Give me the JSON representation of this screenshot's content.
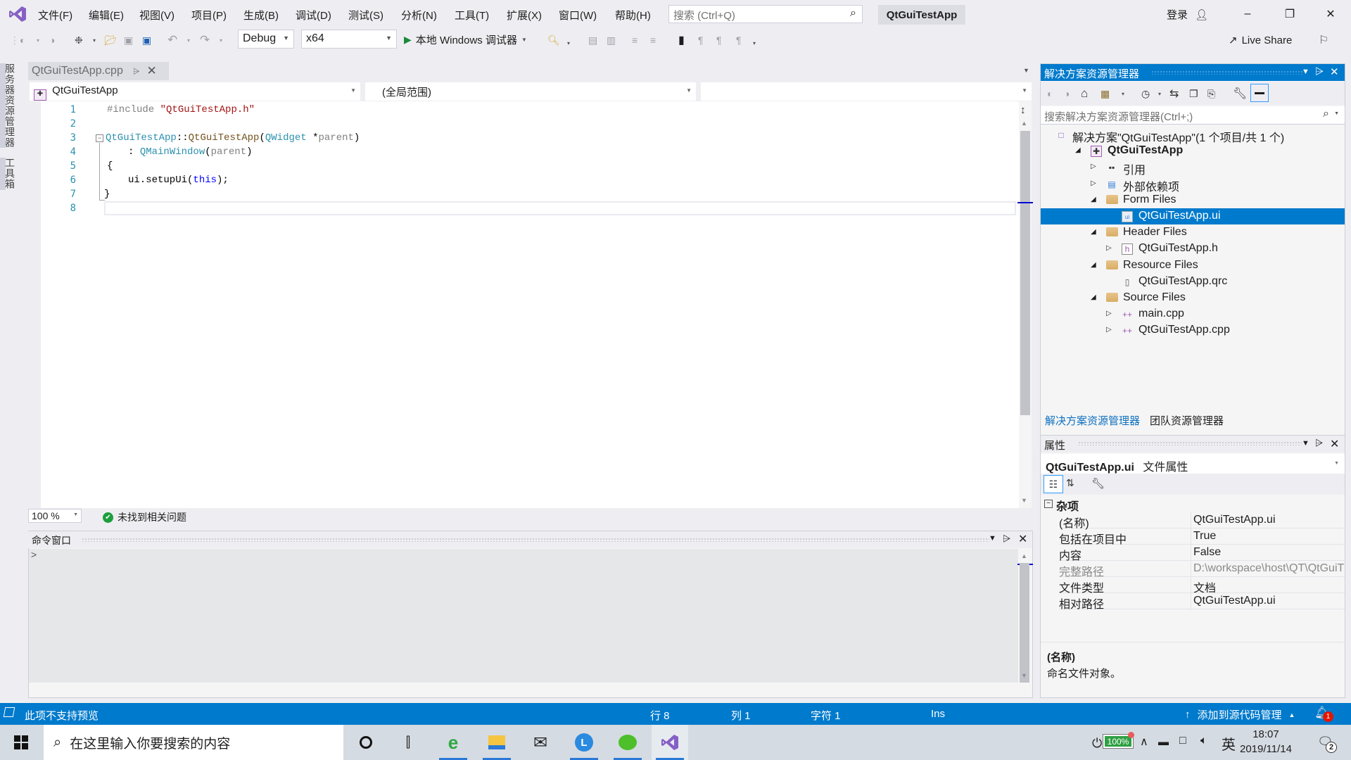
{
  "menubar": {
    "items": [
      "文件(F)",
      "编辑(E)",
      "视图(V)",
      "项目(P)",
      "生成(B)",
      "调试(D)",
      "测试(S)",
      "分析(N)",
      "工具(T)",
      "扩展(X)",
      "窗口(W)",
      "帮助(H)"
    ],
    "search_placeholder": "搜索 (Ctrl+Q)",
    "solution_name": "QtGuiTestApp",
    "login_label": "登录"
  },
  "toolbar": {
    "configuration": "Debug",
    "platform": "x64",
    "run_label": "本地 Windows 调试器",
    "live_share_label": "Live Share"
  },
  "left_strip": {
    "tabs": [
      "服务器资源管理器",
      "工具箱"
    ]
  },
  "editor": {
    "tab_label": "QtGuiTestApp.cpp",
    "project_scope": "QtGuiTestApp",
    "global_scope": "(全局范围)",
    "member_scope": "",
    "line_numbers": [
      "1",
      "2",
      "3",
      "4",
      "5",
      "6",
      "7",
      "8"
    ],
    "zoom": "100 %",
    "issues_status": "未找到相关问题"
  },
  "code": {
    "line1": {
      "directive": "#include ",
      "string": "\"QtGuiTestApp.h\""
    },
    "line3": {
      "cls": "QtGuiTestApp",
      "sep": "::",
      "fn": "QtGuiTestApp",
      "open": "(",
      "type": "QWidget",
      "rest": " *",
      "param": "parent",
      "close": ")"
    },
    "line4": {
      "colon": ": ",
      "type": "QMainWindow",
      "open": "(",
      "param": "parent",
      "close": ")"
    },
    "line5": "{",
    "line6": {
      "pre": "ui.setupUi(",
      "kw": "this",
      "post": ");"
    },
    "line7": "}"
  },
  "command_window": {
    "title": "命令窗口",
    "prompt": ">"
  },
  "solution_explorer": {
    "title": "解决方案资源管理器",
    "search_placeholder": "搜索解决方案资源管理器(Ctrl+;)",
    "tree": [
      {
        "label": "解决方案\"QtGuiTestApp\"(1 个项目/共 1 个)",
        "level": 0,
        "twisty": "",
        "icon": "solution-icon"
      },
      {
        "label": "QtGuiTestApp",
        "level": 1,
        "twisty": "expanded",
        "icon": "project-icon"
      },
      {
        "label": "引用",
        "level": 2,
        "twisty": "collapsed",
        "icon": "references-icon"
      },
      {
        "label": "外部依赖项",
        "level": 2,
        "twisty": "collapsed",
        "icon": "external-deps-icon"
      },
      {
        "label": "Form Files",
        "level": 2,
        "twisty": "expanded",
        "icon": "folder-icon"
      },
      {
        "label": "QtGuiTestApp.ui",
        "level": 3,
        "twisty": "",
        "icon": "ui-file-icon",
        "selected": true
      },
      {
        "label": "Header Files",
        "level": 2,
        "twisty": "expanded",
        "icon": "folder-icon"
      },
      {
        "label": "QtGuiTestApp.h",
        "level": 3,
        "twisty": "collapsed",
        "icon": "header-file-icon"
      },
      {
        "label": "Resource Files",
        "level": 2,
        "twisty": "expanded",
        "icon": "folder-icon"
      },
      {
        "label": "QtGuiTestApp.qrc",
        "level": 3,
        "twisty": "",
        "icon": "file-icon"
      },
      {
        "label": "Source Files",
        "level": 2,
        "twisty": "expanded",
        "icon": "folder-icon"
      },
      {
        "label": "main.cpp",
        "level": 3,
        "twisty": "collapsed",
        "icon": "cpp-file-icon"
      },
      {
        "label": "QtGuiTestApp.cpp",
        "level": 3,
        "twisty": "collapsed",
        "icon": "cpp-file-icon"
      }
    ],
    "bottom_tabs": [
      "解决方案资源管理器",
      "团队资源管理器"
    ]
  },
  "properties": {
    "title": "属性",
    "subject_name": "QtGuiTestApp.ui",
    "subject_type": "文件属性",
    "category": "杂项",
    "rows": [
      {
        "key": "(名称)",
        "value": "QtGuiTestApp.ui"
      },
      {
        "key": "包括在项目中",
        "value": "True"
      },
      {
        "key": "内容",
        "value": "False"
      },
      {
        "key": "完整路径",
        "value": "D:\\workspace\\host\\QT\\QtGuiT"
      },
      {
        "key": "文件类型",
        "value": "文档"
      },
      {
        "key": "相对路径",
        "value": "QtGuiTestApp.ui"
      }
    ],
    "description_title": "(名称)",
    "description_text": "命名文件对象。"
  },
  "statusbar": {
    "message": "此项不支持预览",
    "line": "行 8",
    "col": "列 1",
    "char": "字符 1",
    "mode": "Ins",
    "source_control": "添加到源代码管理",
    "notification_count": "1"
  },
  "taskbar": {
    "search_placeholder": "在这里输入你要搜索的内容",
    "battery": "100%",
    "ime": "英",
    "time": "18:07",
    "date": "2019/11/14",
    "action_center_count": "2"
  },
  "colors": {
    "accent": "#007acc",
    "background": "#eeeef2",
    "line_number": "#2b91af",
    "keyword": "#0000ff",
    "string": "#a31515"
  }
}
